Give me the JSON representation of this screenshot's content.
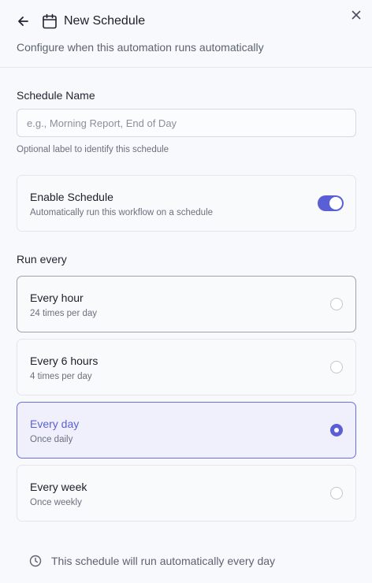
{
  "header": {
    "title": "New Schedule",
    "subtitle": "Configure when this automation runs automatically"
  },
  "schedule_name": {
    "label": "Schedule Name",
    "placeholder": "e.g., Morning Report, End of Day",
    "value": "",
    "hint": "Optional label to identify this schedule"
  },
  "enable": {
    "title": "Enable Schedule",
    "description": "Automatically run this workflow on a schedule",
    "on": true
  },
  "run_every": {
    "label": "Run every",
    "options": [
      {
        "title": "Every hour",
        "subtitle": "24 times per day",
        "selected": false
      },
      {
        "title": "Every 6 hours",
        "subtitle": "4 times per day",
        "selected": false
      },
      {
        "title": "Every day",
        "subtitle": "Once daily",
        "selected": true
      },
      {
        "title": "Every week",
        "subtitle": "Once weekly",
        "selected": false
      }
    ]
  },
  "footer": {
    "text": "This schedule will run automatically every day"
  },
  "colors": {
    "accent": "#5b5fd6",
    "selected_bg": "#eff0fc",
    "background": "#f8f9fc",
    "border": "#e3e5ea"
  },
  "icons": [
    "arrow-left-icon",
    "calendar-icon",
    "close-icon",
    "clock-icon"
  ]
}
